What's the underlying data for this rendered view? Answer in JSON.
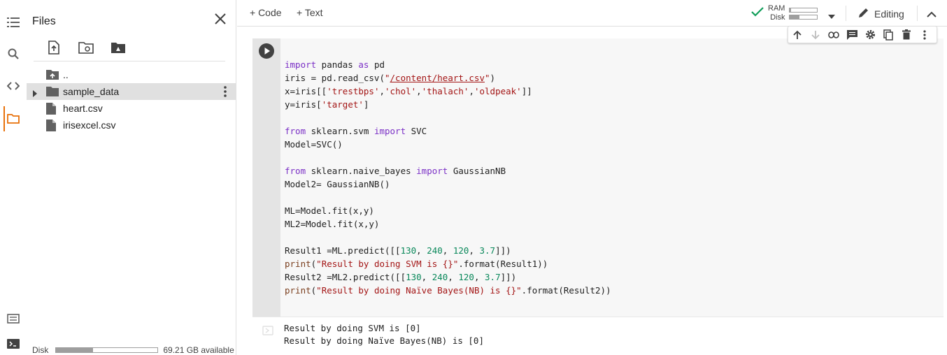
{
  "files_panel": {
    "title": "Files",
    "tree": [
      {
        "label": "..",
        "icon": "upload-folder-icon"
      },
      {
        "label": "sample_data",
        "icon": "folder-icon",
        "expandable": true,
        "selected": true
      },
      {
        "label": "heart.csv",
        "icon": "file-icon"
      },
      {
        "label": "irisexcel.csv",
        "icon": "file-icon"
      }
    ],
    "disk": {
      "label": "Disk",
      "available": "69.21 GB available",
      "used_fraction": 0.36
    }
  },
  "toolbar": {
    "add_code": "+ Code",
    "add_text": "+ Text",
    "ram_label": "RAM",
    "disk_label": "Disk",
    "ram_fraction": 0.05,
    "disk_fraction": 0.36,
    "editing_label": "Editing"
  },
  "cell": {
    "code_lines": [
      "import pandas as pd",
      "iris = pd.read_csv(\"/content/heart.csv\")",
      "x=iris[['trestbps','chol','thalach','oldpeak']]",
      "y=iris['target']",
      "",
      "from sklearn.svm import SVC",
      "Model=SVC()",
      "",
      "from sklearn.naive_bayes import GaussianNB",
      "Model2= GaussianNB()",
      "",
      "ML=Model.fit(x,y)",
      "ML2=Model.fit(x,y)",
      "",
      "Result1 =ML.predict([[130, 240, 120, 3.7]])",
      "print(\"Result by doing SVM is {}\".format(Result1))",
      "Result2 =ML2.predict([[130, 240, 120, 3.7]])",
      "print(\"Result by doing Naïve Bayes(NB) is {}\".format(Result2))"
    ],
    "output_lines": [
      "Result by doing SVM is [0]",
      "Result by doing Naïve Bayes(NB) is [0]"
    ]
  },
  "colors": {
    "accent": "#e8710a",
    "check": "#0f9d58"
  }
}
